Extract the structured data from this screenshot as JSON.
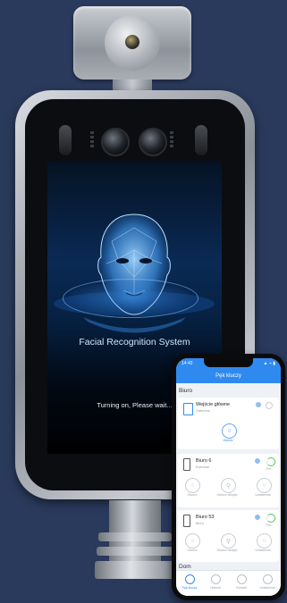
{
  "kiosk": {
    "screen_title": "Facial Recognition System",
    "screen_status": "Turning on, Please wait..."
  },
  "phone": {
    "status_time": "14:42",
    "status_icons": "▲ ⌁ ▮",
    "nav_title": "Pęk kluczy",
    "sections": [
      {
        "title": "Biuro"
      },
      {
        "title": "Dom"
      }
    ],
    "devices": [
      {
        "name": "Wejście główne",
        "subtitle": "Gateview",
        "actions": [
          {
            "label": "Otwórz",
            "active": true
          }
        ]
      },
      {
        "name": "Biuro 6",
        "subtitle": "Eventual",
        "battery": "70%",
        "actions": [
          {
            "label": "Otwórz",
            "active": false
          },
          {
            "label": "Otwórz wkrętki",
            "active": false
          },
          {
            "label": "Ustawienia",
            "active": false
          }
        ]
      },
      {
        "name": "Biuro 53",
        "subtitle": "Biuro",
        "battery": "70%",
        "actions": [
          {
            "label": "Otwórz",
            "active": false
          },
          {
            "label": "Otwórz wkrętki",
            "active": false
          },
          {
            "label": "Ustawienia",
            "active": false
          }
        ]
      }
    ],
    "tabs": [
      {
        "label": "Pęk kluczy",
        "active": true
      },
      {
        "label": "Historia",
        "active": false
      },
      {
        "label": "Kontakt",
        "active": false
      },
      {
        "label": "Ustawienia",
        "active": false
      }
    ],
    "colors": {
      "accent": "#2f8af0",
      "battery": "#4cc45a"
    }
  }
}
